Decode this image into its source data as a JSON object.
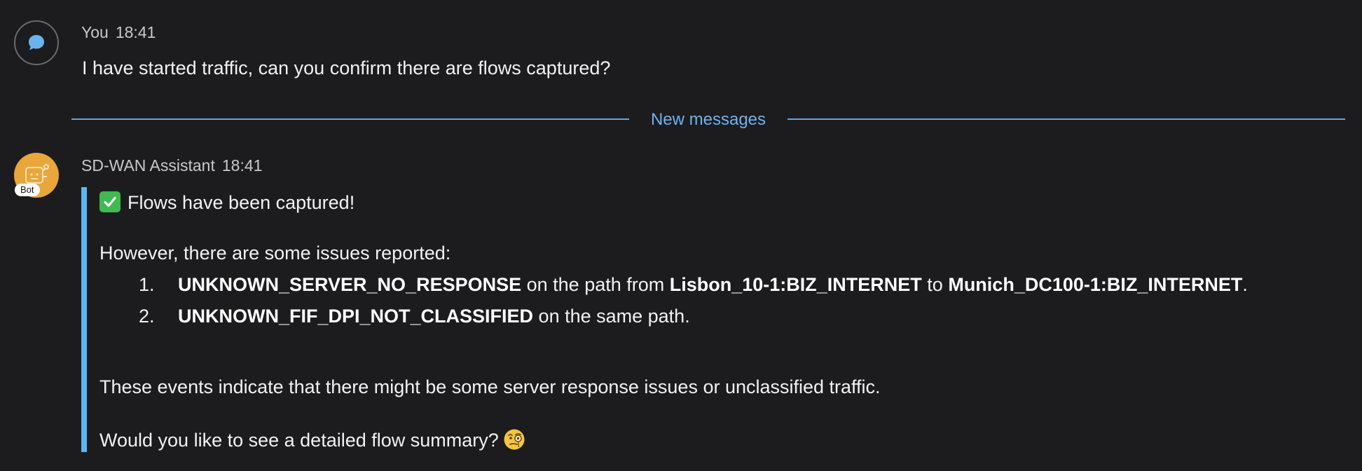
{
  "messages": {
    "user": {
      "author": "You",
      "time": "18:41",
      "text": "I have started traffic, can you confirm there are flows captured?"
    },
    "divider_label": "New messages",
    "bot": {
      "author": "SD-WAN Assistant",
      "time": "18:41",
      "badge": "Bot",
      "headline": "Flows have been captured!",
      "intro": "However, there are some issues reported:",
      "issues": [
        {
          "number": "1.",
          "code": "UNKNOWN_SERVER_NO_RESPONSE",
          "text_a": " on the path from ",
          "source": "Lisbon_10-1:BIZ_INTERNET",
          "text_b": " to ",
          "destination": "Munich_DC100-1:BIZ_INTERNET",
          "text_c": "."
        },
        {
          "number": "2.",
          "code": "UNKNOWN_FIF_DPI_NOT_CLASSIFIED",
          "text_a": " on the same path."
        }
      ],
      "explanation": "These events indicate that there might be some server response issues or unclassified traffic.",
      "question": "Would you like to see a detailed flow summary?"
    }
  },
  "icons": {
    "user_avatar": "chat-bubble-icon",
    "bot_avatar": "robot-icon",
    "headline_emoji": "check-mark-icon",
    "question_emoji": "monocle-face-icon"
  },
  "colors": {
    "background": "#1c1c1e",
    "accent_blue": "#5fa7e8",
    "quote_bar": "#5cb8f2",
    "bot_avatar": "#e9a63a",
    "check_green": "#3fb950"
  }
}
